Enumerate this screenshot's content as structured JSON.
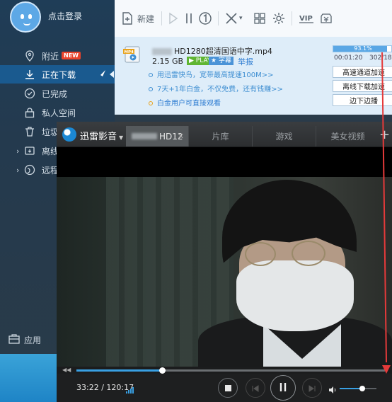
{
  "sidebar": {
    "login_text": "点击登录",
    "items": [
      {
        "label": "附近",
        "badge": "NEW",
        "icon": "location-icon"
      },
      {
        "label": "正在下载",
        "icon": "download-icon"
      },
      {
        "label": "已完成",
        "icon": "check-circle-icon"
      },
      {
        "label": "私人空间",
        "icon": "lock-icon"
      },
      {
        "label": "垃圾",
        "icon": "trash-icon"
      },
      {
        "label": "离线",
        "icon": "offline-icon"
      },
      {
        "label": "远程",
        "icon": "remote-icon"
      }
    ],
    "bottom_label": "应用"
  },
  "toolbar": {
    "new_label": "新建",
    "icons": [
      "new-task-icon",
      "play-icon",
      "pause-icon",
      "one-icon",
      "delete-icon",
      "grid-icon",
      "settings-icon",
      "vip-icon",
      "coin-icon"
    ]
  },
  "task": {
    "file_name": "HD1280超清国语中字.mp4",
    "file_size": "2.15 GB",
    "play_tag": "PLAY",
    "sub_tag": "字幕",
    "report_link": "举报",
    "progress_text": "93.1%",
    "progress_value": 0.931,
    "elapsed": "00:01:20",
    "stat": "302/18",
    "promos": [
      "用迅雷快鸟，宽带最高提速100M>>",
      "7天+1年白金，不仅免费，还有钱赚>>",
      "白金用户可直接观看"
    ],
    "buttons": [
      "高速通道加速",
      "离线下载加速",
      "边下边播"
    ]
  },
  "player": {
    "name": "迅雷影音",
    "active_tab": "HD12",
    "tabs": [
      "片库",
      "游戏",
      "美女视频"
    ],
    "add_tab": "+",
    "current_time": "33:22",
    "total_time": "120:17",
    "seek_value": 0.2774,
    "volume_value": 0.62
  },
  "colors": {
    "accent": "#39a0e3",
    "sidebar_active": "#1a5a8f",
    "badge": "#e8432b",
    "annotation": "#e53a3a"
  }
}
